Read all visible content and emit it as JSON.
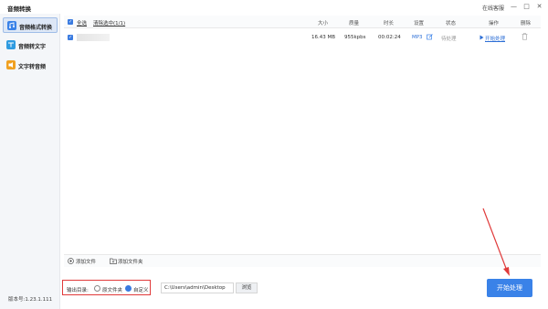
{
  "window": {
    "title": "音频转换",
    "service_label": "在线客服",
    "minimize_glyph": "—",
    "maximize_glyph": "□",
    "close_glyph": "✕"
  },
  "sidebar": {
    "items": [
      {
        "label": "音频格式转换",
        "icon": "audio-convert-icon",
        "active": true
      },
      {
        "label": "音频转文字",
        "icon": "audio-to-text-icon",
        "active": false
      },
      {
        "label": "文字转音频",
        "icon": "text-to-audio-icon",
        "active": false
      }
    ],
    "version": "版本号:1.23.1.111"
  },
  "table": {
    "select_all": "全选",
    "clear_selected": "清除选中(1/1)",
    "columns": {
      "size": "大小",
      "quality": "质量",
      "duration": "时长",
      "settings": "设置",
      "status": "状态",
      "action": "操作",
      "delete": "删除"
    },
    "rows": [
      {
        "size": "16.43 MB",
        "quality": "955kpbs",
        "duration": "00:02:24",
        "format": "MP3",
        "status": "待处理",
        "action": "开始处理"
      }
    ]
  },
  "footer": {
    "add_file": "添加文件",
    "add_folder": "添加文件夹"
  },
  "output": {
    "label": "输出目录:",
    "option_source": "原文件夹",
    "option_custom": "自定义",
    "selected": "自定义",
    "path": "C:\\Users\\admin\\Desktop",
    "browse": "浏览"
  },
  "start_button": "开始处理",
  "colors": {
    "accent": "#3a82e8",
    "highlight_box": "#e03a3a",
    "arrow": "#e03a3a"
  }
}
